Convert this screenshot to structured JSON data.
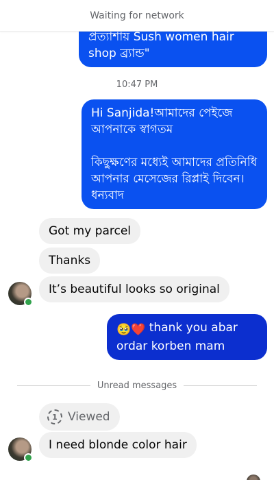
{
  "status_bar": {
    "text": "Waiting for network"
  },
  "messages": {
    "outgoing_top": {
      "text": "প্রত্যাশায় Sush women hair shop ব্র্যান্ড\""
    },
    "timestamp": "10:47 PM",
    "outgoing_greeting": {
      "line1": "Hi Sanjida!আমাদের পেইজে আপনাকে স্বাগতম",
      "line2": "কিছুক্ষণের মধ্যেই আমাদের প্রতিনিধি আপনার মেসেজের রিপ্লাই দিবেন। ধন্যবাদ"
    },
    "incoming": [
      {
        "text": "Got my parcel"
      },
      {
        "text": "Thanks"
      },
      {
        "text": "It’s beautiful looks so original"
      }
    ],
    "outgoing_thanks": {
      "emojis": "🥹❤️",
      "text": "thank you abar ordar korben mam"
    },
    "divider": "Unread messages",
    "viewed": {
      "label": "Viewed",
      "icon_text": "1"
    },
    "incoming_last": {
      "text": "I need blonde color hair"
    }
  },
  "colors": {
    "outgoing_bubble": "#0a51f0",
    "outgoing_bubble_alt": "#0c2fcf",
    "incoming_bubble": "#f0f0f0",
    "online": "#31a24c"
  },
  "icons": {
    "online_indicator": "green-dot",
    "viewed_icon": "view-once-icon"
  }
}
